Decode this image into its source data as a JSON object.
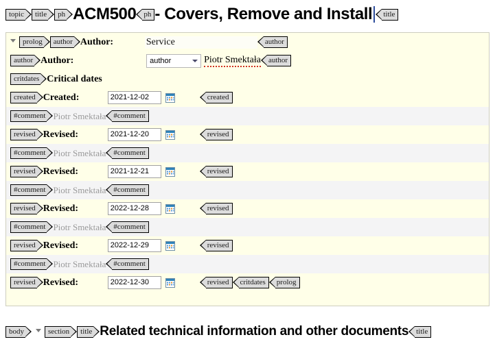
{
  "document": {
    "title_tags": [
      "topic",
      "title",
      "ph"
    ],
    "title_ph_text": "ACM500",
    "title_ph_close": "ph",
    "title_rest": " - Covers, Remove and Install",
    "title_close_tag": "title"
  },
  "prolog": {
    "open_tag": "prolog",
    "close_tag": "prolog",
    "rows": [
      {
        "type": "author-service",
        "open_tag": "author",
        "label": "Author:",
        "value": "Service",
        "close_tag": "author"
      },
      {
        "type": "author-select",
        "open_tag": "author",
        "label": "Author:",
        "select_value": "author",
        "value": "Piotr Smektała",
        "close_tag": "author"
      },
      {
        "type": "heading",
        "open_tag": "critdates",
        "label": "Critical dates"
      },
      {
        "type": "date",
        "open_tag": "created",
        "label": "Created:",
        "value": "2021-12-02",
        "close_tag": "created"
      },
      {
        "type": "comment",
        "open_tag": "#comment",
        "value": "Piotr Smektała",
        "close_tag": "#comment"
      },
      {
        "type": "date",
        "open_tag": "revised",
        "label": "Revised:",
        "value": "2021-12-20",
        "close_tag": "revised"
      },
      {
        "type": "comment",
        "open_tag": "#comment",
        "value": "Piotr Smektała",
        "close_tag": "#comment"
      },
      {
        "type": "date",
        "open_tag": "revised",
        "label": "Revised:",
        "value": "2021-12-21",
        "close_tag": "revised"
      },
      {
        "type": "comment",
        "open_tag": "#comment",
        "value": "Piotr Smektała",
        "close_tag": "#comment"
      },
      {
        "type": "date",
        "open_tag": "revised",
        "label": "Revised:",
        "value": "2022-12-28",
        "close_tag": "revised"
      },
      {
        "type": "comment",
        "open_tag": "#comment",
        "value": "Piotr Smektała",
        "close_tag": "#comment"
      },
      {
        "type": "date",
        "open_tag": "revised",
        "label": "Revised:",
        "value": "2022-12-29",
        "close_tag": "revised"
      },
      {
        "type": "comment",
        "open_tag": "#comment",
        "value": "Piotr Smektała",
        "close_tag": "#comment"
      },
      {
        "type": "date-last",
        "open_tag": "revised",
        "label": "Revised:",
        "value": "2022-12-30",
        "close_tag": "revised",
        "close_tag_2": "critdates",
        "close_tag_3": "prolog"
      }
    ]
  },
  "section": {
    "body_tag": "body",
    "section_tag": "section",
    "title_tag": "title",
    "title_text": "Related technical information and other documents",
    "title_close_tag": "title"
  },
  "icons": {
    "calendar": "calendar-icon",
    "chevron": "chevron-down-icon",
    "collapse": "collapse-triangle-icon"
  },
  "colors": {
    "prolog_background": "#ffffe8",
    "comment_background": "#f4f4f5",
    "tag_background": "#dcdcdc",
    "caret": "#2b4b9b",
    "spellcheck_underline": "#d03020",
    "comment_text": "#9a9a9a"
  }
}
